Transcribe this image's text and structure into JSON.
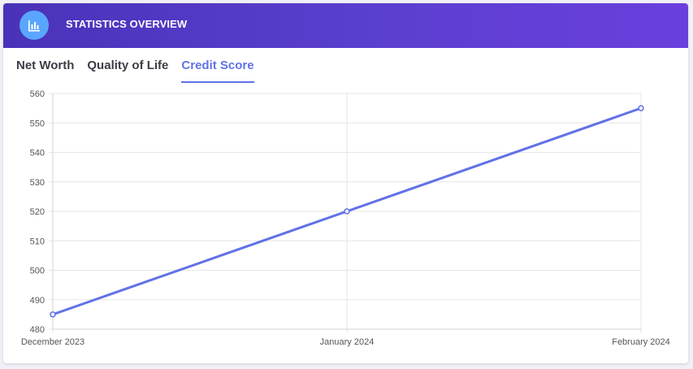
{
  "header": {
    "title": "STATISTICS OVERVIEW",
    "icon": "bar-chart-icon",
    "gradient_start": "#4a32b8",
    "gradient_end": "#6a3fdc",
    "icon_bg": "#5aa6ff"
  },
  "tabs": [
    {
      "label": "Net Worth",
      "active": false
    },
    {
      "label": "Quality of Life",
      "active": false
    },
    {
      "label": "Credit Score",
      "active": true
    }
  ],
  "colors": {
    "accent": "#6172e6",
    "line": "#6172e6",
    "grid": "#e6e6e6"
  },
  "chart_data": {
    "type": "line",
    "categories": [
      "December 2023",
      "January 2024",
      "February 2024"
    ],
    "values": [
      485,
      520,
      555
    ],
    "ylim": [
      480,
      560
    ],
    "yticks": [
      480,
      490,
      500,
      510,
      520,
      530,
      540,
      550,
      560
    ],
    "grid": true,
    "legend": "none"
  }
}
